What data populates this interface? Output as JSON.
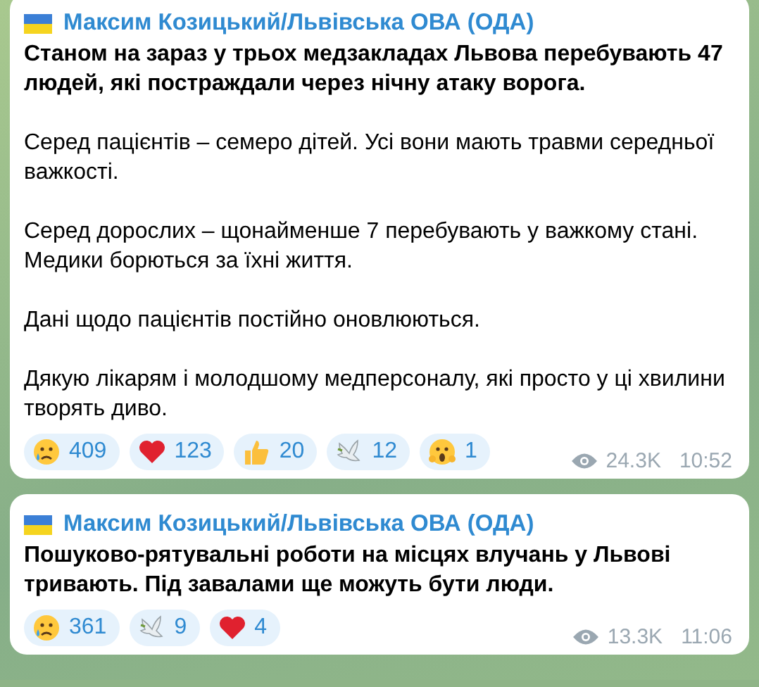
{
  "messages": [
    {
      "sender": "Максим Козицький/Львівська ОВА (ОДА)",
      "paragraphs": [
        {
          "text": "Станом на зараз у трьох медзакладах Львова перебувають 47 людей, які постраждали через нічну атаку ворога.",
          "bold": true
        },
        {
          "text": "Серед пацієнтів – семеро дітей. Усі вони мають травми середньої важкості.",
          "bold": false
        },
        {
          "text": "Серед дорослих – щонайменше 7 перебувають у важкому стані. Медики борються за їхні життя.",
          "bold": false
        },
        {
          "text": "Дані щодо пацієнтів постійно оновлюються.",
          "bold": false
        },
        {
          "text": "Дякую лікарям і молодшому медперсоналу, які просто у ці хвилини творять диво.",
          "bold": false
        }
      ],
      "reactions": [
        {
          "kind": "crying",
          "count": "409"
        },
        {
          "kind": "heart",
          "count": "123"
        },
        {
          "kind": "thumbs",
          "count": "20"
        },
        {
          "kind": "dove",
          "count": "12"
        },
        {
          "kind": "scream",
          "count": "1"
        }
      ],
      "views": "24.3K",
      "time": "10:52"
    },
    {
      "sender": "Максим Козицький/Львівська ОВА (ОДА)",
      "paragraphs": [
        {
          "text": "Пошуково-рятувальні роботи на місцях влучань у Львові тривають. Під завалами ще можуть бути люди.",
          "bold": true
        }
      ],
      "reactions": [
        {
          "kind": "crying",
          "count": "361"
        },
        {
          "kind": "dove",
          "count": "9"
        },
        {
          "kind": "heart",
          "count": "4"
        }
      ],
      "views": "13.3K",
      "time": "11:06"
    }
  ]
}
